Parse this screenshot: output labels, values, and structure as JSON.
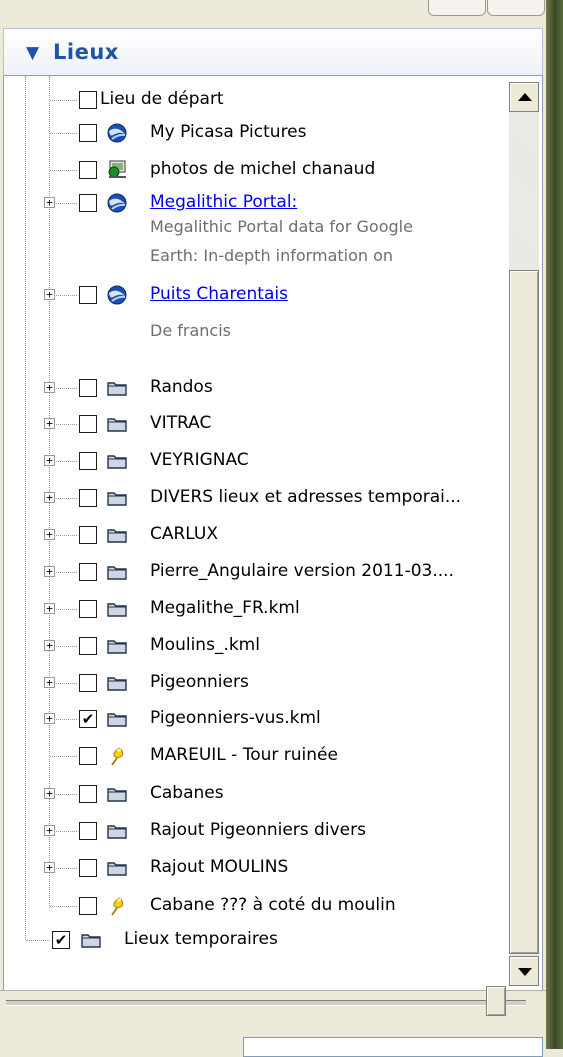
{
  "panel": {
    "title": "Lieux",
    "colors": {
      "title": "#1e53a8",
      "link": "#0000ee",
      "description": "#6e6e6e"
    }
  },
  "items": [
    {
      "label": "Lieu de départ",
      "icon": "none",
      "checked": false,
      "expander": false,
      "link": false
    },
    {
      "label": "My Picasa Pictures",
      "icon": "earth-globe-icon",
      "checked": false,
      "expander": false,
      "link": false
    },
    {
      "label": "photos de michel chanaud",
      "icon": "network-photo-icon",
      "checked": false,
      "expander": false,
      "link": false
    },
    {
      "label": "Megalithic Portal:",
      "icon": "earth-globe-icon",
      "checked": false,
      "expander": true,
      "link": true,
      "description": [
        "Megalithic Portal data for Google",
        "Earth: In-depth information on"
      ]
    },
    {
      "label": "Puits Charentais",
      "icon": "earth-globe-icon",
      "checked": false,
      "expander": true,
      "link": true,
      "description": [
        "De francis"
      ]
    },
    {
      "label": "Randos",
      "icon": "folder-icon",
      "checked": false,
      "expander": true,
      "link": false
    },
    {
      "label": "VITRAC",
      "icon": "folder-icon",
      "checked": false,
      "expander": true,
      "link": false
    },
    {
      "label": "VEYRIGNAC",
      "icon": "folder-icon",
      "checked": false,
      "expander": true,
      "link": false
    },
    {
      "label": "DIVERS lieux et adresses temporai...",
      "icon": "folder-icon",
      "checked": false,
      "expander": true,
      "link": false
    },
    {
      "label": "CARLUX",
      "icon": "folder-icon",
      "checked": false,
      "expander": true,
      "link": false
    },
    {
      "label": "Pierre_Angulaire version 2011-03....",
      "icon": "folder-icon",
      "checked": false,
      "expander": true,
      "link": false
    },
    {
      "label": "Megalithe_FR.kml",
      "icon": "folder-icon",
      "checked": false,
      "expander": true,
      "link": false
    },
    {
      "label": "Moulins_.kml",
      "icon": "folder-icon",
      "checked": false,
      "expander": true,
      "link": false
    },
    {
      "label": "Pigeonniers",
      "icon": "folder-icon",
      "checked": false,
      "expander": true,
      "link": false
    },
    {
      "label": "Pigeonniers-vus.kml",
      "icon": "folder-icon",
      "checked": true,
      "expander": true,
      "link": false
    },
    {
      "label": "MAREUIL - Tour ruinée",
      "icon": "yellow-pushpin-icon",
      "checked": false,
      "expander": false,
      "link": false
    },
    {
      "label": "Cabanes",
      "icon": "folder-icon",
      "checked": false,
      "expander": true,
      "link": false
    },
    {
      "label": "Rajout Pigeonniers divers",
      "icon": "folder-icon",
      "checked": false,
      "expander": true,
      "link": false
    },
    {
      "label": "Rajout MOULINS",
      "icon": "folder-icon",
      "checked": false,
      "expander": true,
      "link": false
    },
    {
      "label": "Cabane ??? à coté du moulin",
      "icon": "yellow-pushpin-icon",
      "checked": false,
      "expander": false,
      "link": false
    }
  ],
  "root_item": {
    "label": "Lieux temporaires",
    "icon": "folder-icon",
    "checked": true
  },
  "slider": {
    "value": 0.96
  }
}
